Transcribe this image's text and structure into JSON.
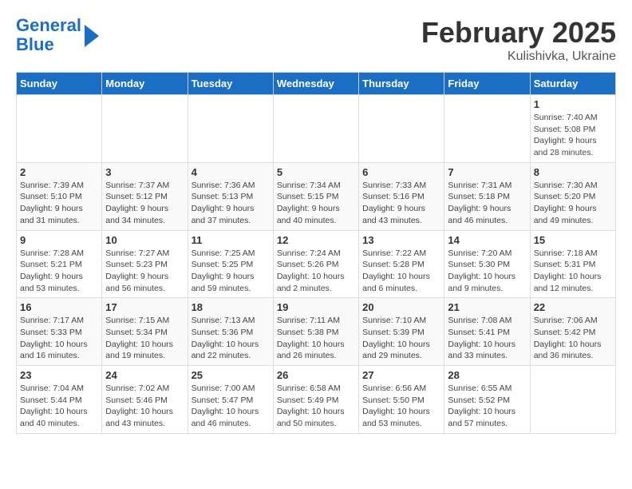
{
  "logo": {
    "line1": "General",
    "line2": "Blue"
  },
  "title": "February 2025",
  "subtitle": "Kulishivka, Ukraine",
  "days_of_week": [
    "Sunday",
    "Monday",
    "Tuesday",
    "Wednesday",
    "Thursday",
    "Friday",
    "Saturday"
  ],
  "weeks": [
    [
      {
        "day": "",
        "info": ""
      },
      {
        "day": "",
        "info": ""
      },
      {
        "day": "",
        "info": ""
      },
      {
        "day": "",
        "info": ""
      },
      {
        "day": "",
        "info": ""
      },
      {
        "day": "",
        "info": ""
      },
      {
        "day": "1",
        "info": "Sunrise: 7:40 AM\nSunset: 5:08 PM\nDaylight: 9 hours and 28 minutes."
      }
    ],
    [
      {
        "day": "2",
        "info": "Sunrise: 7:39 AM\nSunset: 5:10 PM\nDaylight: 9 hours and 31 minutes."
      },
      {
        "day": "3",
        "info": "Sunrise: 7:37 AM\nSunset: 5:12 PM\nDaylight: 9 hours and 34 minutes."
      },
      {
        "day": "4",
        "info": "Sunrise: 7:36 AM\nSunset: 5:13 PM\nDaylight: 9 hours and 37 minutes."
      },
      {
        "day": "5",
        "info": "Sunrise: 7:34 AM\nSunset: 5:15 PM\nDaylight: 9 hours and 40 minutes."
      },
      {
        "day": "6",
        "info": "Sunrise: 7:33 AM\nSunset: 5:16 PM\nDaylight: 9 hours and 43 minutes."
      },
      {
        "day": "7",
        "info": "Sunrise: 7:31 AM\nSunset: 5:18 PM\nDaylight: 9 hours and 46 minutes."
      },
      {
        "day": "8",
        "info": "Sunrise: 7:30 AM\nSunset: 5:20 PM\nDaylight: 9 hours and 49 minutes."
      }
    ],
    [
      {
        "day": "9",
        "info": "Sunrise: 7:28 AM\nSunset: 5:21 PM\nDaylight: 9 hours and 53 minutes."
      },
      {
        "day": "10",
        "info": "Sunrise: 7:27 AM\nSunset: 5:23 PM\nDaylight: 9 hours and 56 minutes."
      },
      {
        "day": "11",
        "info": "Sunrise: 7:25 AM\nSunset: 5:25 PM\nDaylight: 9 hours and 59 minutes."
      },
      {
        "day": "12",
        "info": "Sunrise: 7:24 AM\nSunset: 5:26 PM\nDaylight: 10 hours and 2 minutes."
      },
      {
        "day": "13",
        "info": "Sunrise: 7:22 AM\nSunset: 5:28 PM\nDaylight: 10 hours and 6 minutes."
      },
      {
        "day": "14",
        "info": "Sunrise: 7:20 AM\nSunset: 5:30 PM\nDaylight: 10 hours and 9 minutes."
      },
      {
        "day": "15",
        "info": "Sunrise: 7:18 AM\nSunset: 5:31 PM\nDaylight: 10 hours and 12 minutes."
      }
    ],
    [
      {
        "day": "16",
        "info": "Sunrise: 7:17 AM\nSunset: 5:33 PM\nDaylight: 10 hours and 16 minutes."
      },
      {
        "day": "17",
        "info": "Sunrise: 7:15 AM\nSunset: 5:34 PM\nDaylight: 10 hours and 19 minutes."
      },
      {
        "day": "18",
        "info": "Sunrise: 7:13 AM\nSunset: 5:36 PM\nDaylight: 10 hours and 22 minutes."
      },
      {
        "day": "19",
        "info": "Sunrise: 7:11 AM\nSunset: 5:38 PM\nDaylight: 10 hours and 26 minutes."
      },
      {
        "day": "20",
        "info": "Sunrise: 7:10 AM\nSunset: 5:39 PM\nDaylight: 10 hours and 29 minutes."
      },
      {
        "day": "21",
        "info": "Sunrise: 7:08 AM\nSunset: 5:41 PM\nDaylight: 10 hours and 33 minutes."
      },
      {
        "day": "22",
        "info": "Sunrise: 7:06 AM\nSunset: 5:42 PM\nDaylight: 10 hours and 36 minutes."
      }
    ],
    [
      {
        "day": "23",
        "info": "Sunrise: 7:04 AM\nSunset: 5:44 PM\nDaylight: 10 hours and 40 minutes."
      },
      {
        "day": "24",
        "info": "Sunrise: 7:02 AM\nSunset: 5:46 PM\nDaylight: 10 hours and 43 minutes."
      },
      {
        "day": "25",
        "info": "Sunrise: 7:00 AM\nSunset: 5:47 PM\nDaylight: 10 hours and 46 minutes."
      },
      {
        "day": "26",
        "info": "Sunrise: 6:58 AM\nSunset: 5:49 PM\nDaylight: 10 hours and 50 minutes."
      },
      {
        "day": "27",
        "info": "Sunrise: 6:56 AM\nSunset: 5:50 PM\nDaylight: 10 hours and 53 minutes."
      },
      {
        "day": "28",
        "info": "Sunrise: 6:55 AM\nSunset: 5:52 PM\nDaylight: 10 hours and 57 minutes."
      },
      {
        "day": "",
        "info": ""
      }
    ]
  ]
}
